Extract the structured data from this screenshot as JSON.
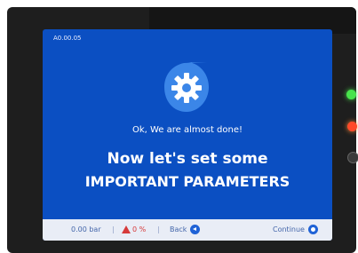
{
  "screen": {
    "id_code": "A0.00.05",
    "subtitle": "Ok, We are almost done!",
    "headline_line1": "Now let's set some",
    "headline_line2": "IMPORTANT PARAMETERS"
  },
  "footer": {
    "pressure": "0.00 bar",
    "separator": "|",
    "alarm_value": "0 %",
    "back_label": "Back",
    "continue_label": "Continue"
  },
  "colors": {
    "screen_bg": "#0b4fc2",
    "footer_bg": "#e9edf6",
    "alarm": "#d63a3a",
    "led_green": "#48e34c",
    "led_red": "#ff4a2a"
  },
  "icons": {
    "logo": "gear-in-drop-icon",
    "back": "chevron-left-circle-icon",
    "continue": "circle-dot-icon",
    "alarm": "warning-triangle-icon"
  }
}
